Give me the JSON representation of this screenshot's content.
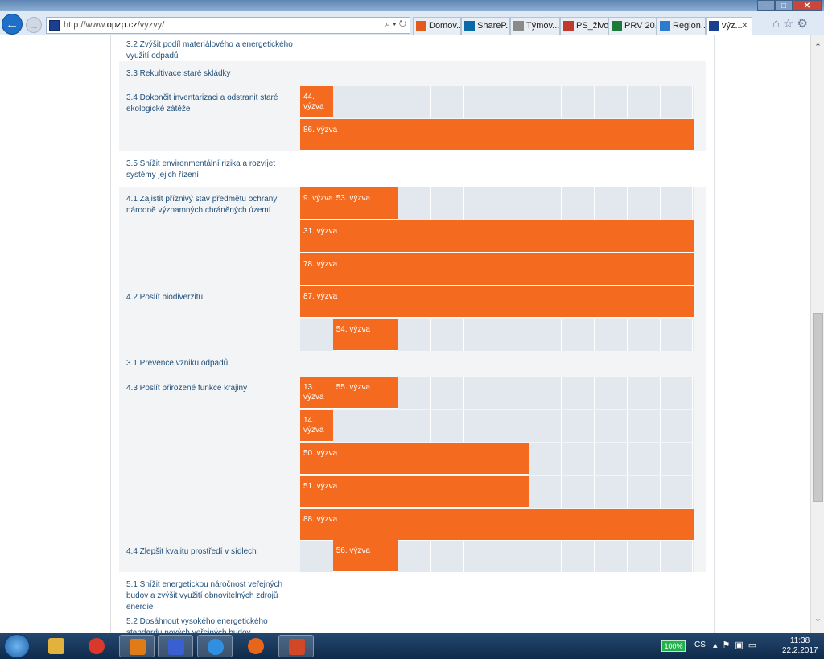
{
  "browser": {
    "url_prefix": "http://www.",
    "url_domain": "opzp.cz",
    "url_path": "/vyzvy/",
    "address_controls": "⌕ ▾ ↻",
    "tabs": [
      {
        "label": "Domov...",
        "icon_color": "#e25a1c"
      },
      {
        "label": "ShareP...",
        "icon_color": "#0a6aa8"
      },
      {
        "label": "Týmov...",
        "icon_color": "#8a8a8a"
      },
      {
        "label": "PS_živo...",
        "icon_color": "#c0392b"
      },
      {
        "label": "PRV 20...",
        "icon_color": "#1d7a3a"
      },
      {
        "label": "Region...",
        "icon_color": "#2c7bd0"
      },
      {
        "label": "výz...",
        "icon_color": "#1b3f8f"
      }
    ],
    "active_tab_index": 6,
    "tab_close": "✕",
    "window_min": "–",
    "window_max": "□",
    "window_close": "✕",
    "toolbar_icons": "⌂☆⚙"
  },
  "rows": [
    {
      "label": "3.2 Zvýšit podíl materiálového a energetického využití odpadů"
    },
    {
      "label": "3.3 Rekultivace staré skládky"
    },
    {
      "label": "3.4 Dokončit inventarizaci a odstranit staré ekologické zátěže"
    },
    {
      "label": "3.5 Snížit environmentální rizika a rozvíjet systémy jejich řízení"
    },
    {
      "label": "4.1 Zajistit příznivý stav předmětu ochrany národně významných chráněných území"
    },
    {
      "label": "4.2 Poslít biodiverzitu"
    },
    {
      "label": "3.1 Prevence vzniku odpadů"
    },
    {
      "label": "4.3 Poslít přirozené funkce krajiny"
    },
    {
      "label": "4.4 Zlepšit kvalitu prostředí v sídlech"
    },
    {
      "label": "5.1 Snížit energetickou náročnost veřejných budov a zvýšit využití obnovitelných zdrojů energie"
    },
    {
      "label": "5.2 Dosáhnout vysokého energetického standardu nových veřejných budov"
    }
  ],
  "bars": [
    {
      "label": "44. výzva",
      "row": "3.4",
      "line": 0,
      "start_col": 0,
      "span": 1
    },
    {
      "label": "86. výzva",
      "row": "3.4",
      "line": 1,
      "start_col": 0,
      "span": 12
    },
    {
      "label": "9. výzva",
      "row": "4.1",
      "line": 0,
      "start_col": 0,
      "span": 1
    },
    {
      "label": "53. výzva",
      "row": "4.1",
      "line": 0,
      "start_col": 1,
      "span": 2
    },
    {
      "label": "31. výzva",
      "row": "4.1",
      "line": 1,
      "start_col": 0,
      "span": 12
    },
    {
      "label": "78. výzva",
      "row": "4.1",
      "line": 2,
      "start_col": 0,
      "span": 12
    },
    {
      "label": "87. výzva",
      "row": "4.2",
      "line": 0,
      "start_col": 0,
      "span": 12
    },
    {
      "label": "54. výzva",
      "row": "4.2",
      "line": 1,
      "start_col": 1,
      "span": 2
    },
    {
      "label": "13. výzva",
      "row": "4.3",
      "line": 0,
      "start_col": 0,
      "span": 1
    },
    {
      "label": "55. výzva",
      "row": "4.3",
      "line": 0,
      "start_col": 1,
      "span": 2
    },
    {
      "label": "14. výzva",
      "row": "4.3",
      "line": 1,
      "start_col": 0,
      "span": 1
    },
    {
      "label": "50. výzva",
      "row": "4.3",
      "line": 2,
      "start_col": 0,
      "span": 7
    },
    {
      "label": "51. výzva",
      "row": "4.3",
      "line": 3,
      "start_col": 0,
      "span": 7
    },
    {
      "label": "88. výzva",
      "row": "4.3",
      "line": 4,
      "start_col": 0,
      "span": 12
    },
    {
      "label": "56. výzva",
      "row": "4.4",
      "line": 0,
      "start_col": 1,
      "span": 2
    }
  ],
  "colors": {
    "bar": "#f46a1f",
    "track": "#e3e8ef",
    "label": "#1f4e79"
  },
  "taskbar": {
    "apps": [
      {
        "name": "explorer",
        "color": "#e3b23c"
      },
      {
        "name": "chrome",
        "color": "#d8392b"
      },
      {
        "name": "outlook",
        "color": "#e07b17"
      },
      {
        "name": "save",
        "color": "#3a5fd0"
      },
      {
        "name": "ie",
        "color": "#2f8fe0"
      },
      {
        "name": "firefox",
        "color": "#e8661c"
      },
      {
        "name": "powerpoint",
        "color": "#d24726"
      }
    ],
    "battery": "100%",
    "lang": "CS",
    "tray_icons": "▴⚑▣▭",
    "time": "11:38",
    "date": "22.2.2017"
  }
}
